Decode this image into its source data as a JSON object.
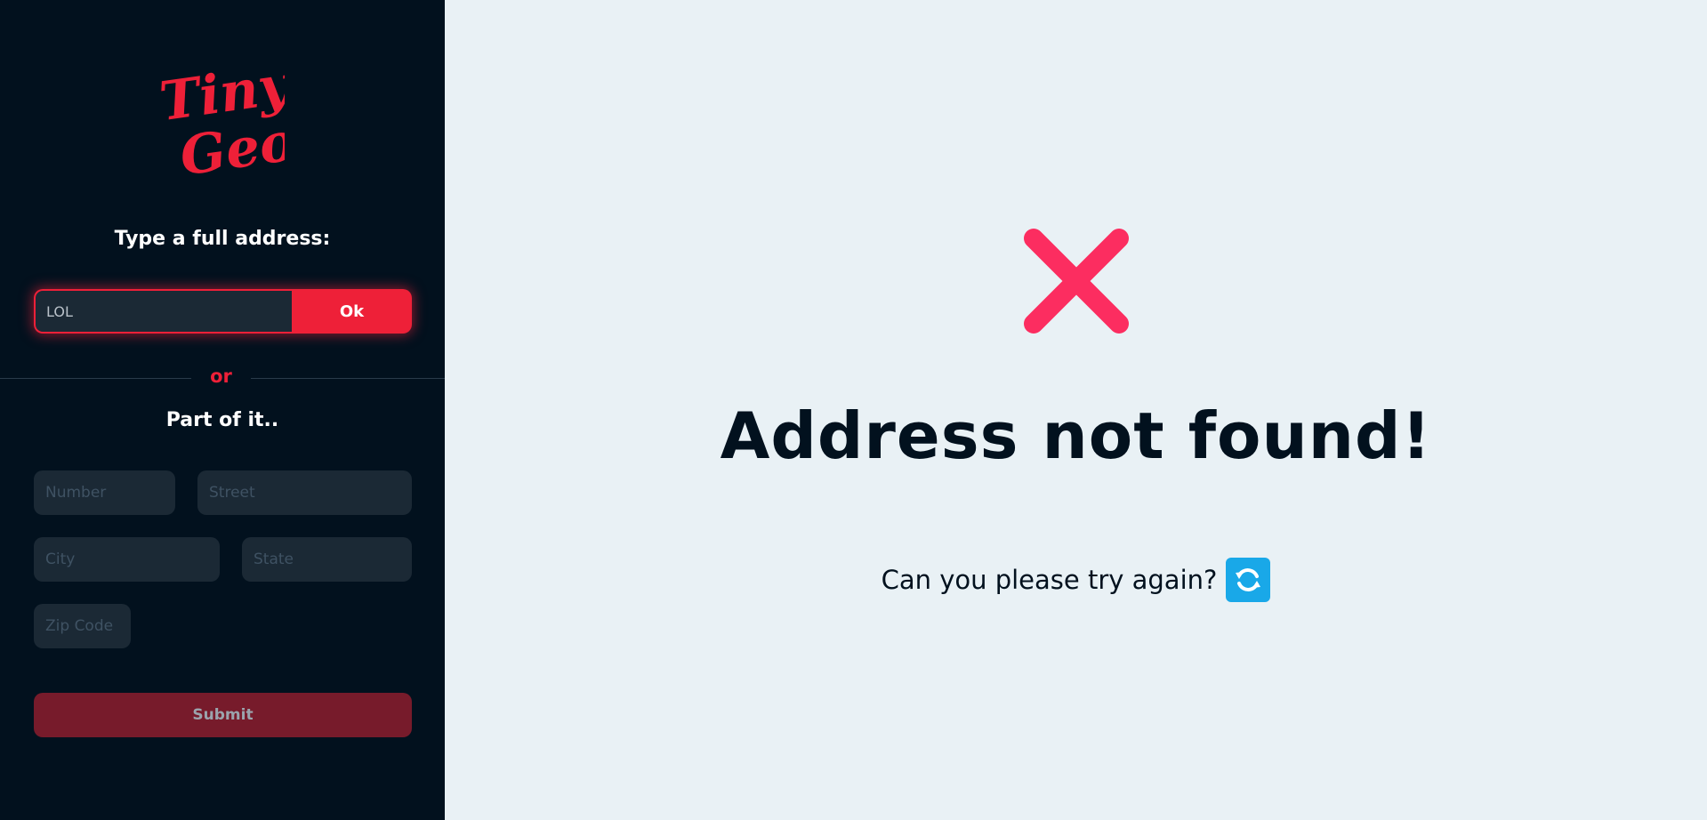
{
  "brand": {
    "logo_text": "Tiny Geo",
    "logo_line1": "Tiny",
    "logo_line2": "Geo",
    "color": "#ee2038"
  },
  "sidebar": {
    "full_address_title": "Type a full address:",
    "full_address_value": "LOL",
    "ok_label": "Ok",
    "divider_label": "or",
    "part_title": "Part of it..",
    "fields": {
      "number_placeholder": "Number",
      "street_placeholder": "Street",
      "city_placeholder": "City",
      "state_placeholder": "State",
      "zip_placeholder": "Zip Code"
    },
    "submit_label": "Submit"
  },
  "main": {
    "error_icon": "close-icon",
    "error_title": "Address not found!",
    "retry_text": "Can you please try again?",
    "retry_icon": "refresh-icon"
  },
  "colors": {
    "sidebar_bg": "#02111e",
    "main_bg": "#e9f1f5",
    "accent": "#ee2038",
    "error_x": "#fc2d60",
    "refresh": "#19a8e8"
  }
}
